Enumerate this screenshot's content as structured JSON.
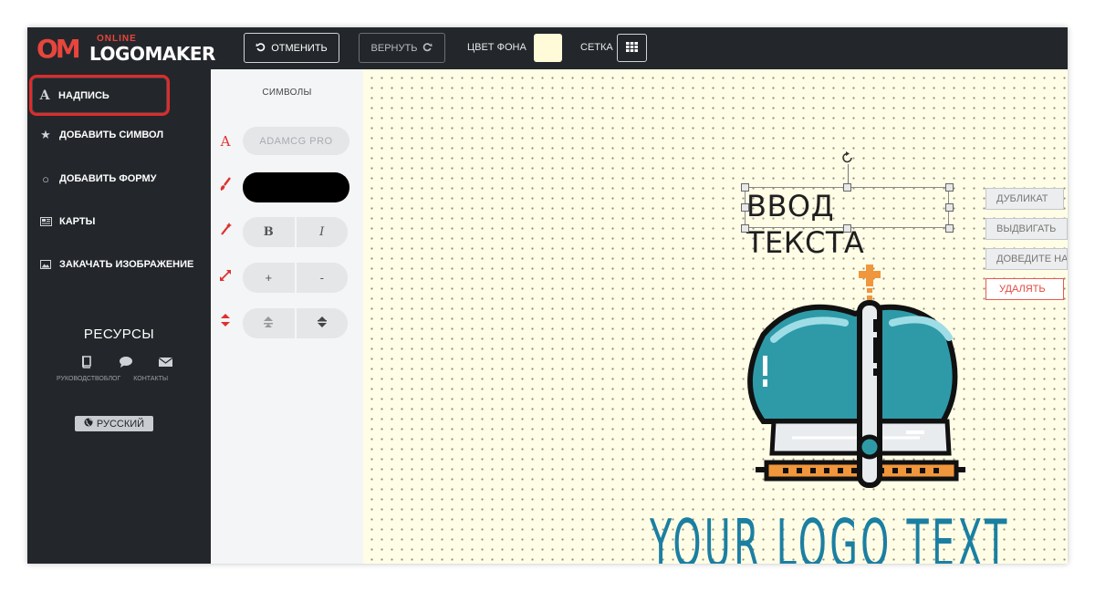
{
  "app": {
    "logo_online": "ONLINE",
    "logo_word": "LOGOMAKER",
    "logo_mark": "OM",
    "brand_color": "#e8453c"
  },
  "toolbar": {
    "undo_label": "ОТМЕНИТЬ",
    "redo_label": "ВЕРНУТЬ",
    "bg_color_label": "ЦВЕТ ФОНА",
    "bg_color": "#fffbd8",
    "grid_label": "СЕТКА"
  },
  "sidebar": {
    "items": [
      {
        "label": "НАДПИСЬ",
        "icon": "text-icon",
        "active": true
      },
      {
        "label": "ДОБАВИТЬ СИМВОЛ",
        "icon": "star-icon"
      },
      {
        "label": "ДОБАВИТЬ ФОРМУ",
        "icon": "circle-icon"
      },
      {
        "label": "КАРТЫ",
        "icon": "map-icon"
      },
      {
        "label": "ЗАКАЧАТЬ ИЗОБРАЖЕНИЕ",
        "icon": "image-icon"
      }
    ],
    "resources_title": "РЕСУРСЫ",
    "resources_links": [
      "РУКОВОДСТВО",
      "БЛОГ",
      "КОНТАКТЫ"
    ],
    "language": "РУССКИЙ"
  },
  "panel": {
    "title": "СИМВОЛЫ",
    "font_name": "ADAMCG PRO",
    "text_color": "#000000",
    "bold_label": "B",
    "italic_label": "I",
    "plus_label": "+",
    "minus_label": "-"
  },
  "canvas": {
    "selected_text": "ВВОД ТЕКСТА",
    "logo_text": "YOUR LOGO TEXT",
    "logo_text_color": "#1b7fa2",
    "side_buttons": [
      "ДУБЛИКАТ",
      "ВЫДВИГАТЬ",
      "ДОВЕДИТЕ НА",
      "УДАЛЯТЬ"
    ]
  }
}
